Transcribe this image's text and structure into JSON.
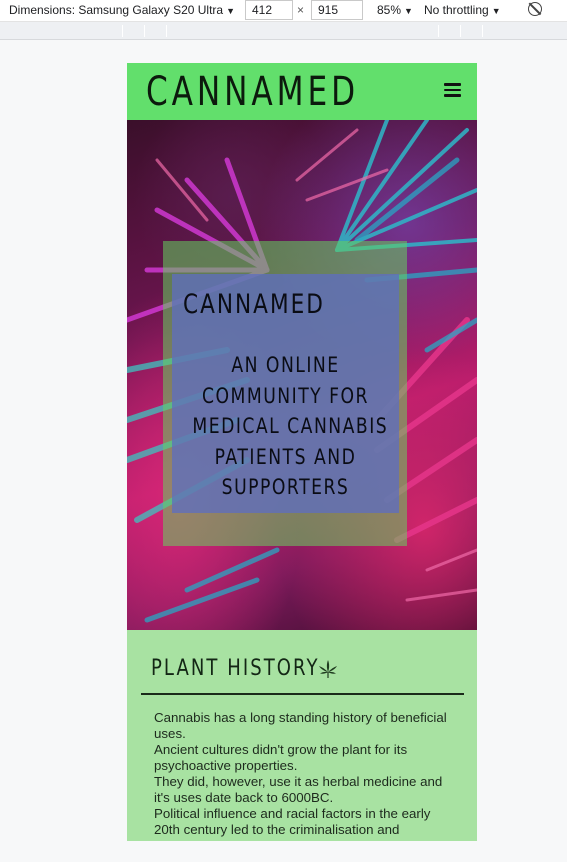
{
  "devtools": {
    "dimensions_label": "Dimensions: Samsung Galaxy S20 Ultra",
    "width": "412",
    "times": "×",
    "height": "915",
    "zoom": "85%",
    "throttling": "No throttling"
  },
  "navbar": {
    "brand": "CANNAMED",
    "menu_icon": "hamburger-menu-icon"
  },
  "hero": {
    "title": "CANNAMED",
    "tagline_lines": [
      "AN ONLINE",
      "COMMUNITY FOR",
      "MEDICAL CANNABIS",
      "PATIENTS AND",
      "SUPPORTERS"
    ]
  },
  "history": {
    "heading": "PLANT HISTORY",
    "heading_icon": "cannabis-leaf-icon",
    "paragraphs": [
      "Cannabis has a long standing history of beneficial uses.",
      "Ancient cultures didn't grow the plant for its psychoactive properties.",
      "They did, however, use it as herbal medicine and it's uses date back to 6000BC.",
      "Political influence and racial factors in the early 20th century led to the criminalisation and"
    ]
  },
  "colors": {
    "navbar": "#62df6c",
    "section_bg": "#a8e2a2",
    "overlay_green": "#64d25f",
    "overlay_blue": "#5f6ebe"
  }
}
